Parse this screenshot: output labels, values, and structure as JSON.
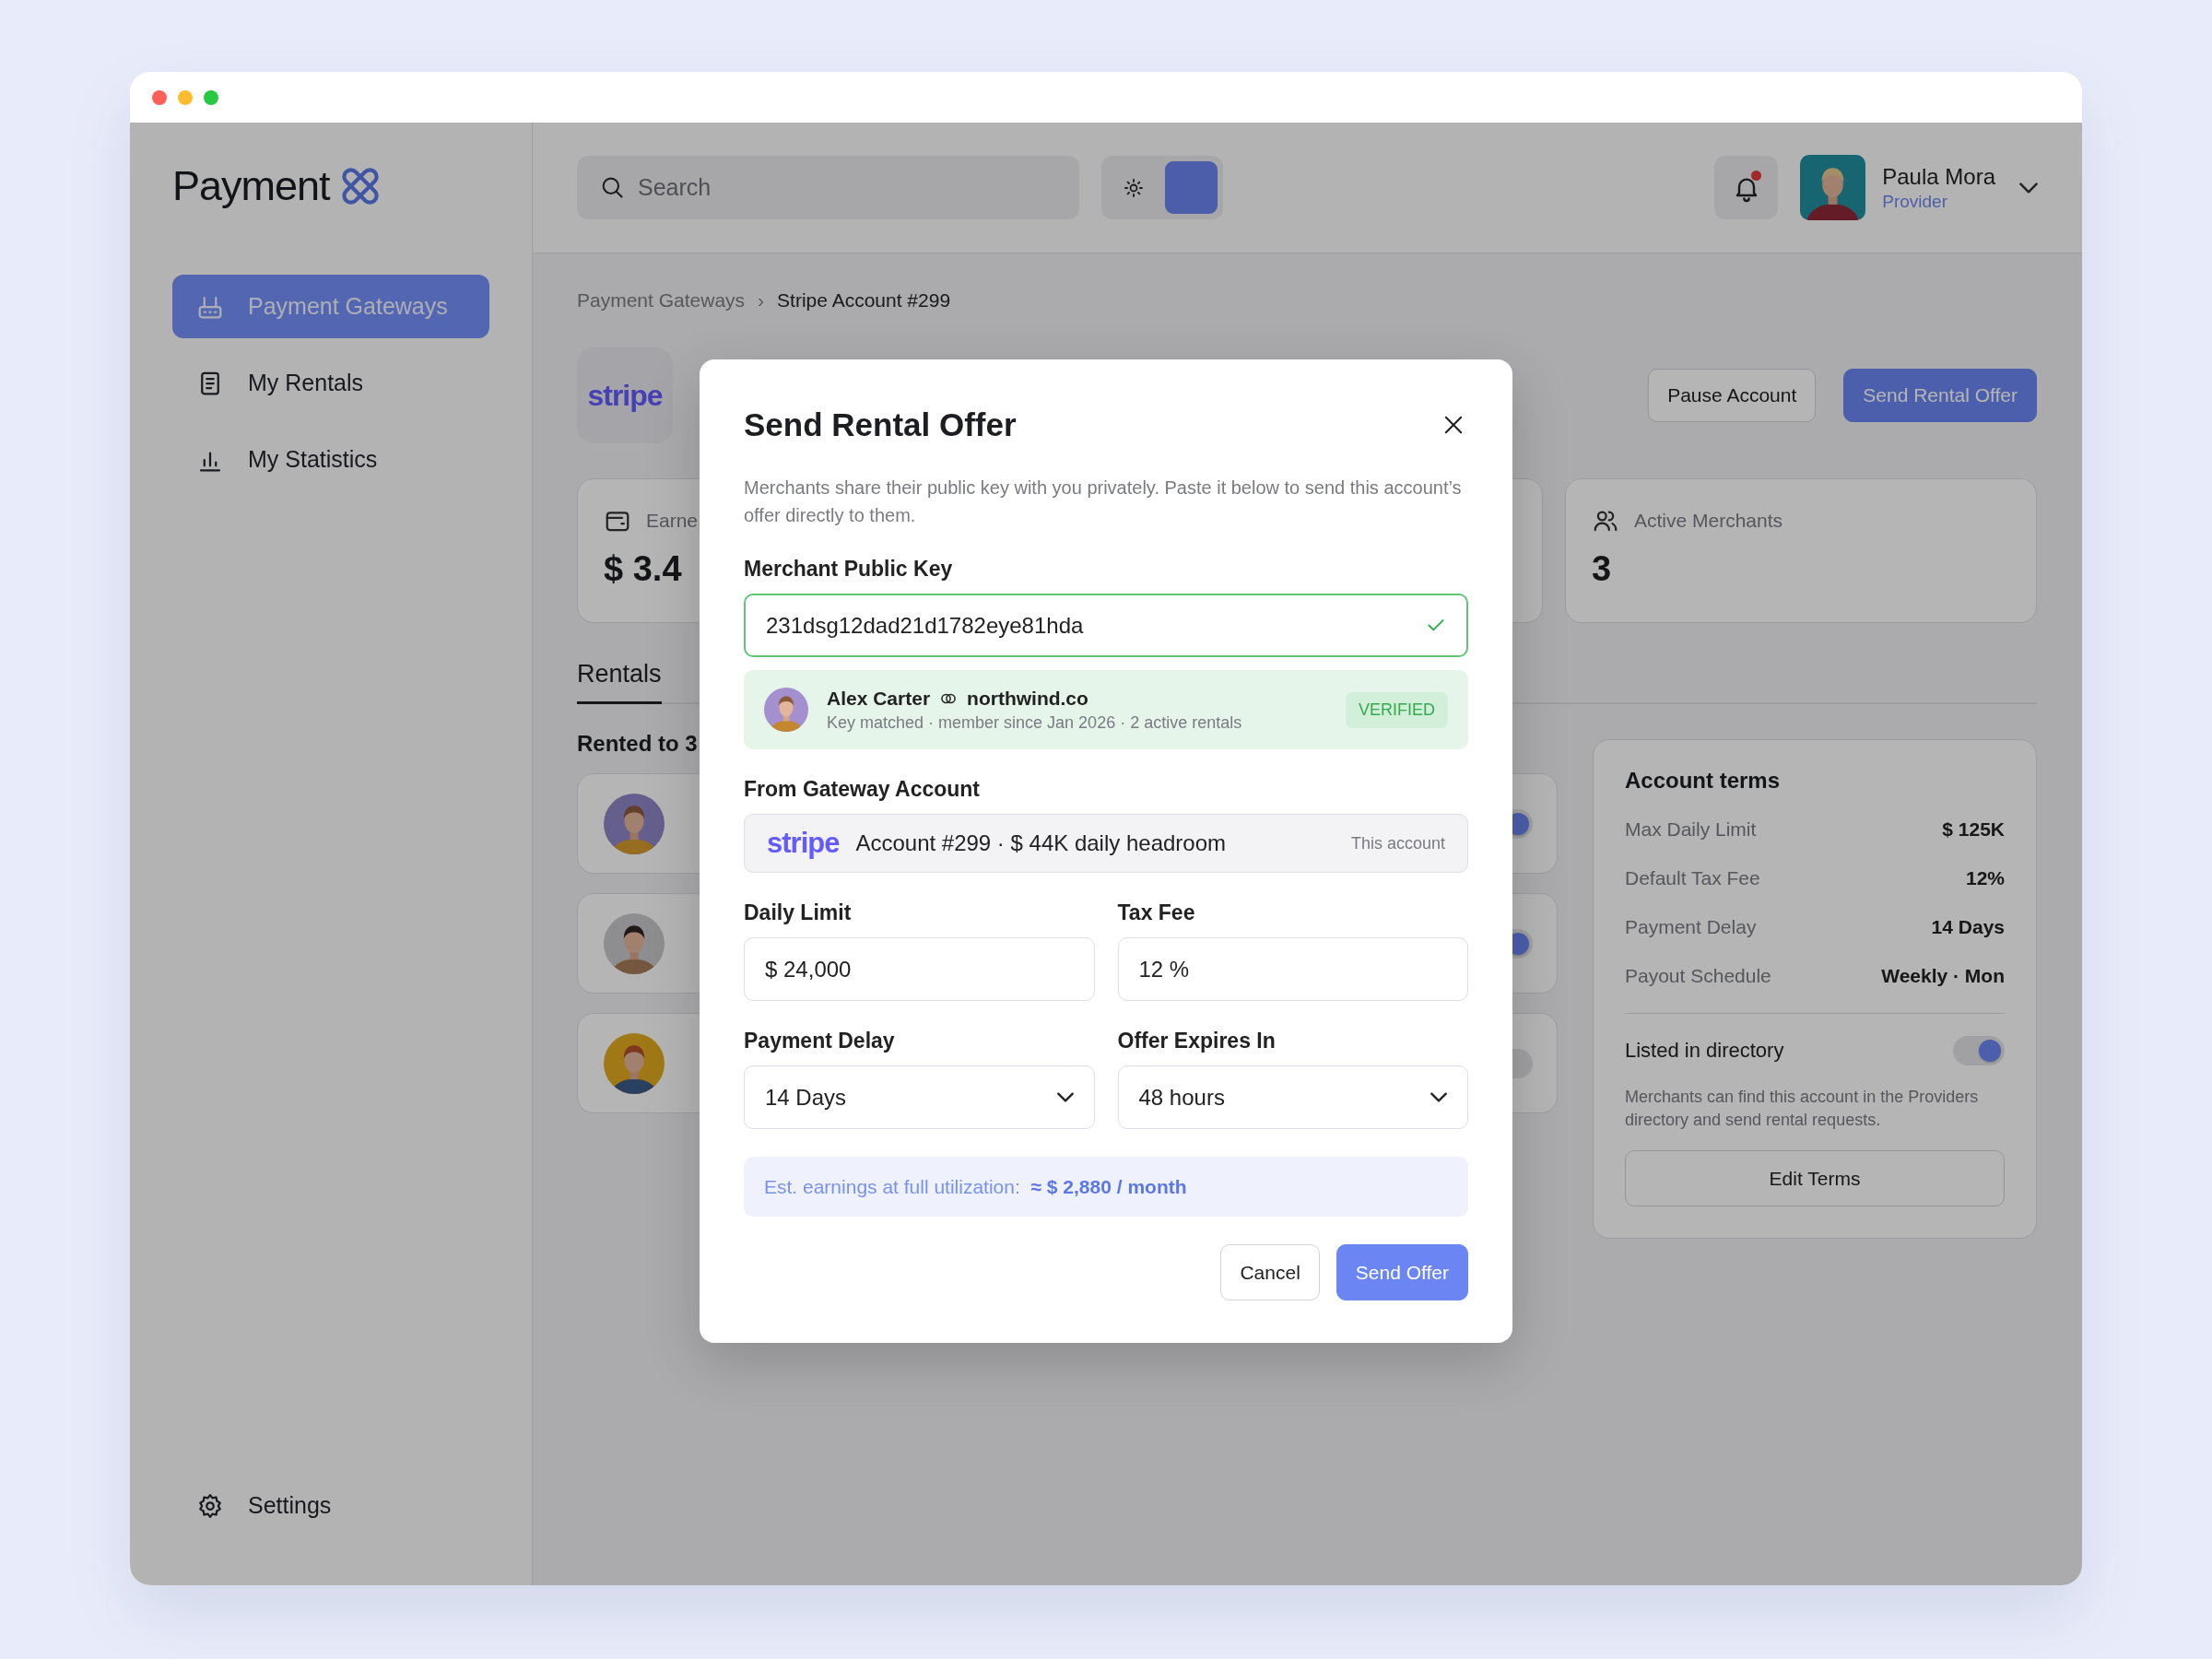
{
  "window": {
    "controls": [
      {
        "color": "#ff5f57"
      },
      {
        "color": "#febc2e"
      },
      {
        "color": "#28c840"
      }
    ]
  },
  "sidebar": {
    "logo": "Payment",
    "nav": [
      {
        "label": "Payment Gateways",
        "selected": true
      },
      {
        "label": "My Rentals",
        "selected": false
      },
      {
        "label": "My Statistics",
        "selected": false
      }
    ],
    "footer": "Settings"
  },
  "header": {
    "search": {
      "placeholder": "Search"
    },
    "theme_switch": [
      {
        "selected": false
      },
      {
        "selected": true
      }
    ],
    "notifications": {
      "unread": true
    },
    "user": {
      "name": "Paula Mora",
      "role": "Provider"
    }
  },
  "breadcrumb": {
    "separator": "›",
    "items": [
      "Payment Gateways",
      "Stripe Account #299"
    ]
  },
  "account": {
    "brand": "stripe",
    "actions": [
      {
        "label": "Pause Account",
        "kind": "secondary"
      },
      {
        "label": "Send Rental Offer",
        "kind": "primary"
      }
    ]
  },
  "stats": [
    {
      "kind": "metric",
      "label": "Earne",
      "value": "$ 3.4"
    },
    {
      "kind": "blank"
    },
    {
      "kind": "metric",
      "label": "Active Merchants",
      "value": "3"
    }
  ],
  "tabs": [
    {
      "label": "Rentals",
      "selected": true
    }
  ],
  "rentals": {
    "title": "Rented to 3",
    "rows": [
      {
        "on": true
      },
      {
        "on": true
      },
      {
        "on": false
      }
    ]
  },
  "terms": {
    "title": "Account terms",
    "rows": [
      {
        "label": "Max Daily Limit",
        "value": "$ 125K"
      },
      {
        "label": "Default Tax Fee",
        "value": "12%"
      },
      {
        "label": "Payment Delay",
        "value": "14 Days"
      },
      {
        "label": "Payout Schedule",
        "value": "Weekly · Mon"
      }
    ],
    "directory": {
      "label": "Listed in directory",
      "on": true
    },
    "note": "Merchants can find this account in the Providers directory and send rental requests.",
    "button": "Edit Terms"
  },
  "modal": {
    "title": "Send Rental Offer",
    "description": "Merchants share their public key with you privately. Paste it below to send this account’s offer directly to them.",
    "key_field": {
      "label": "Merchant Public Key",
      "value": "231dsg12dad21d1782eye81hda",
      "valid": true
    },
    "match": {
      "name": "Alex Carter",
      "company": "northwind.co",
      "detail": "Key matched · member since Jan 2026 · 2 active rentals",
      "badge": "VERIFIED"
    },
    "source": {
      "label": "From Gateway Account",
      "brand": "stripe",
      "account": "Account #299 · $ 44K daily headroom",
      "note": "This account"
    },
    "fields": [
      {
        "label": "Daily Limit",
        "value": "$ 24,000",
        "kind": "text"
      },
      {
        "label": "Tax Fee",
        "value": "12 %",
        "kind": "text"
      },
      {
        "label": "Payment Delay",
        "value": "14 Days",
        "kind": "select"
      },
      {
        "label": "Offer Expires In",
        "value": "48 hours",
        "kind": "select"
      }
    ],
    "estimate": "Est. earnings at full utilization:  **≈ $ 2,880 / month**",
    "buttons": [
      {
        "label": "Cancel",
        "kind": "secondary"
      },
      {
        "label": "Send Offer",
        "kind": "primary"
      }
    ]
  }
}
